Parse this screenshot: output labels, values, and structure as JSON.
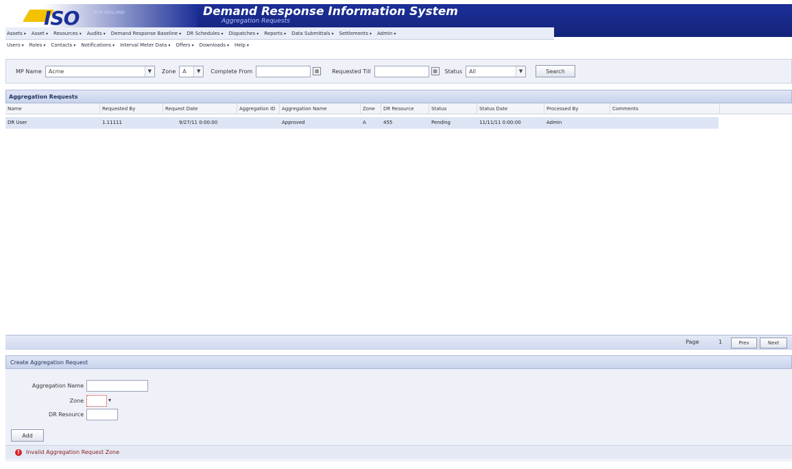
{
  "header": {
    "logo_text": "ISO",
    "logo_sub": "NEW ENGLAND",
    "app_title": "Demand Response Information System",
    "app_subtitle": "Aggregation Requests"
  },
  "menu": {
    "row1": [
      "Assets",
      "Asset",
      "Resources",
      "Audits",
      "Demand Response Baseline",
      "DR Schedules",
      "Dispatches",
      "Reports",
      "Data Submittals",
      "Settlements",
      "Admin"
    ],
    "row2": [
      "Users",
      "Roles",
      "Contacts",
      "Notifications",
      "Interval Meter Data",
      "Offers",
      "Downloads",
      "Help"
    ]
  },
  "filters": {
    "mp_name_label": "MP Name",
    "mp_name_value": "Acme",
    "zone_label": "Zone",
    "zone_value": "A",
    "complete_from_label": "Complete From",
    "requested_till_label": "Requested Till",
    "status_label": "Status",
    "status_value": "All",
    "search_button": "Search"
  },
  "grid": {
    "title": "Aggregation Requests",
    "columns": [
      "Name",
      "Requested By",
      "Request Date",
      "Aggregation ID",
      "Aggregation Name",
      "Zone",
      "DR Resource",
      "Status",
      "Status Date",
      "Processed By",
      "Comments"
    ],
    "rows": [
      [
        "DR User",
        "1.11111",
        "9/27/11 0:00:00",
        "",
        "Approved",
        "A",
        "455",
        "Pending",
        "11/11/11 0:00:00",
        "Admin",
        ""
      ]
    ]
  },
  "pager": {
    "page_label": "Page",
    "page_number": "1",
    "prev_label": "Prev",
    "next_label": "Next"
  },
  "create": {
    "title": "Create Aggregation Request",
    "aggregation_name_label": "Aggregation Name",
    "zone_label": "Zone",
    "dr_resource_label": "DR Resource",
    "add_button": "Add",
    "status_message": "Invalid Aggregation Request Zone"
  }
}
